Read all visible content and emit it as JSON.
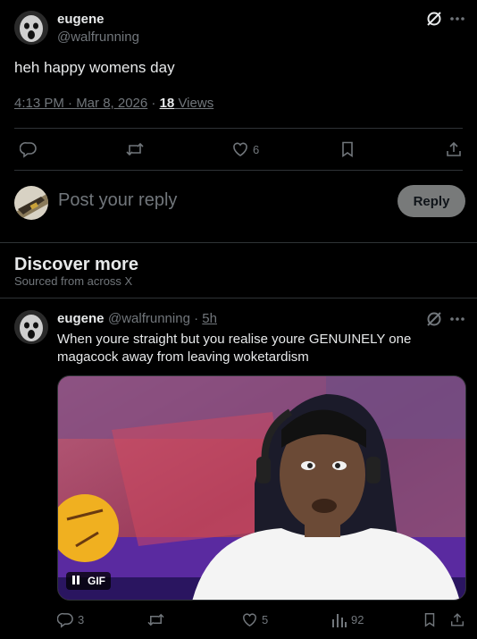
{
  "main_post": {
    "display_name": "eugene",
    "handle": "@walfrunning",
    "text": "heh happy womens day",
    "time": "4:13 PM · Mar 8, 2026",
    "sep": " · ",
    "views_count": "18",
    "views_label": " Views",
    "likes": "6"
  },
  "reply": {
    "placeholder": "Post your reply",
    "button_label": "Reply"
  },
  "discover": {
    "title": "Discover more",
    "subtitle": "Sourced from across X"
  },
  "feed_post": {
    "display_name": "eugene",
    "handle": "@walfrunning",
    "time": "5h",
    "dot": " · ",
    "text": "When youre straight but you realise youre GENUINELY one magacock away from leaving woketardism",
    "gif_label": "GIF",
    "replies": "3",
    "likes": "5",
    "views": "92"
  },
  "colors": {
    "accent": "#1d9bf0",
    "muted": "#71767b",
    "divider": "#2f3336"
  }
}
